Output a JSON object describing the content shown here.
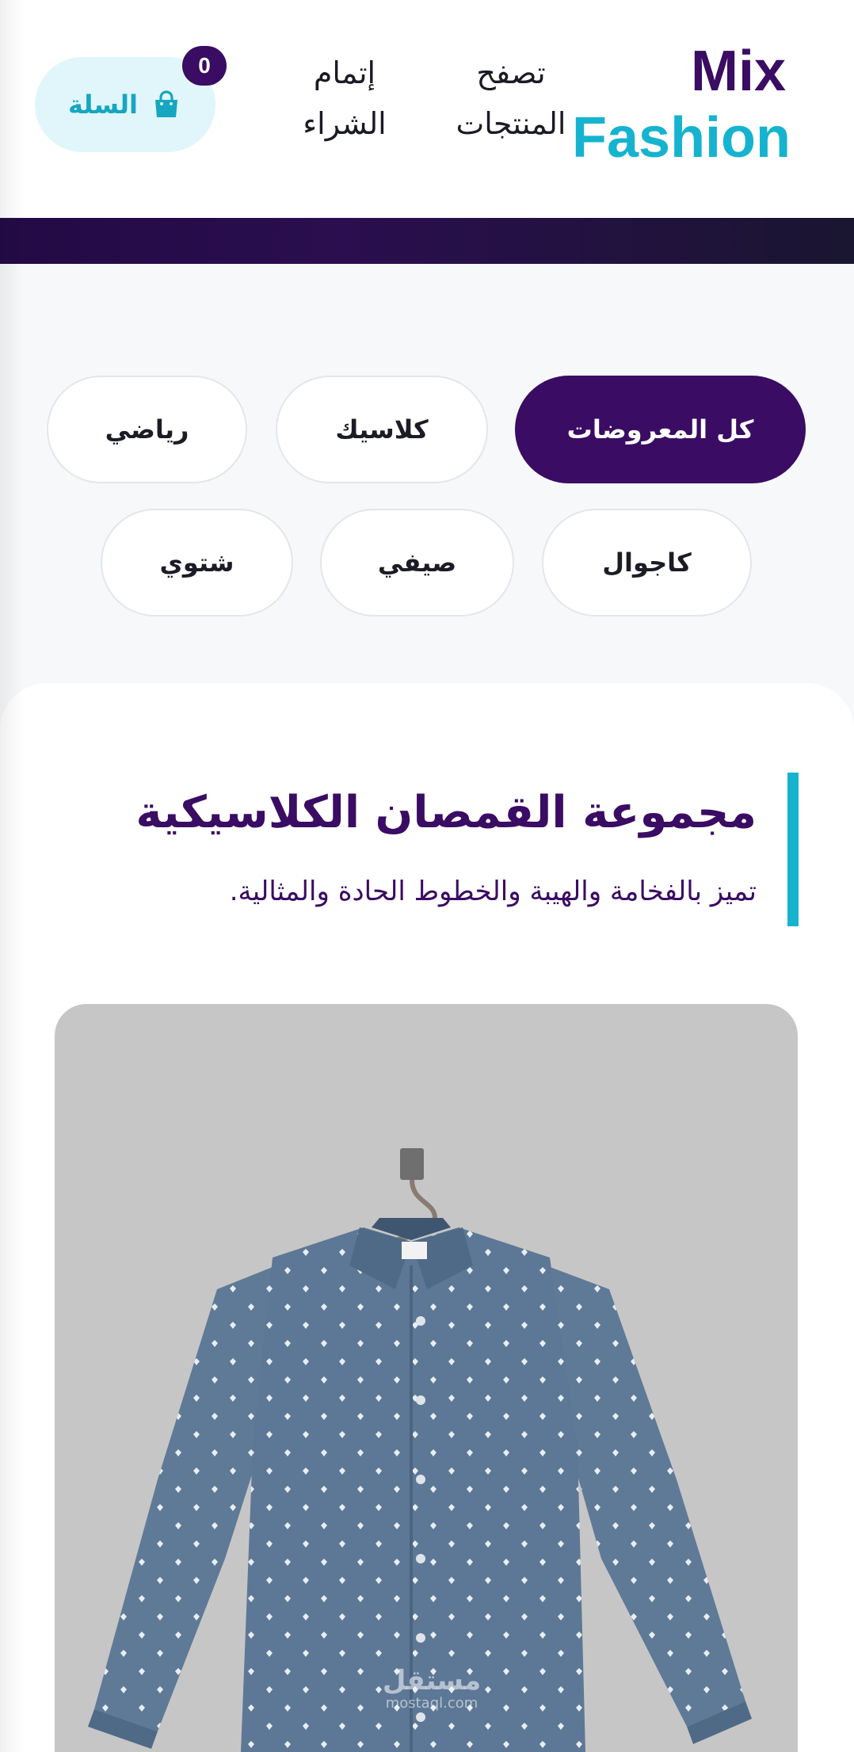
{
  "brand": {
    "line1": "Mix",
    "line2": "Fashion"
  },
  "nav": {
    "browse_line1": "تصفح",
    "browse_line2": "المنتجات",
    "checkout_line1": "إتمام",
    "checkout_line2": "الشراء"
  },
  "cart": {
    "label": "السلة",
    "count": "0",
    "icon": "shopping-bag-icon"
  },
  "filters": [
    {
      "label": "كل المعروضات",
      "active": true
    },
    {
      "label": "كلاسيك",
      "active": false
    },
    {
      "label": "رياضي",
      "active": false
    },
    {
      "label": "كاجوال",
      "active": false
    },
    {
      "label": "صيفي",
      "active": false
    },
    {
      "label": "شتوي",
      "active": false
    }
  ],
  "collection": {
    "title": "مجموعة القمصان الكلاسيكية",
    "subtitle": "تميز بالفخامة والهيبة والخطوط الحادة والمثالية."
  },
  "watermark": {
    "ar": "مستقل",
    "en": "mostaql.com"
  },
  "colors": {
    "primary": "#3a0c63",
    "accent": "#16b3cf",
    "cart_bg": "#e1f6fa",
    "page_bg": "#f7f8fa",
    "product_bg": "#c7c6c6",
    "shirt": "#5e7a97"
  }
}
